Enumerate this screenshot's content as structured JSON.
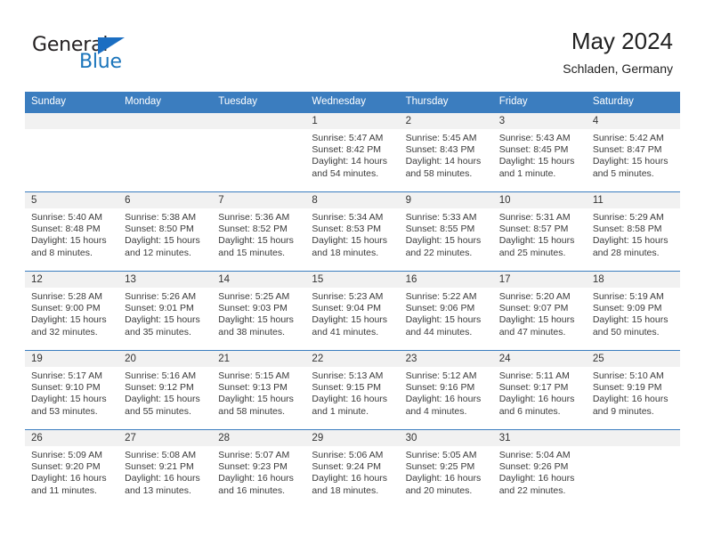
{
  "brand": {
    "name_part1": "General",
    "name_part2": "Blue",
    "flag_icon": "triangle-flag-icon"
  },
  "header": {
    "month_title": "May 2024",
    "location": "Schladen, Germany"
  },
  "colors": {
    "header_blue": "#3b7dbf",
    "brand_blue": "#1b75bb",
    "daynum_strip": "#f1f1f1",
    "text": "#3a3a3a"
  },
  "weekday_headers": [
    "Sunday",
    "Monday",
    "Tuesday",
    "Wednesday",
    "Thursday",
    "Friday",
    "Saturday"
  ],
  "weeks": [
    [
      {
        "day": "",
        "empty": true,
        "sunrise": "",
        "sunset": "",
        "daylight_line1": "",
        "daylight_line2": ""
      },
      {
        "day": "",
        "empty": true,
        "sunrise": "",
        "sunset": "",
        "daylight_line1": "",
        "daylight_line2": ""
      },
      {
        "day": "",
        "empty": true,
        "sunrise": "",
        "sunset": "",
        "daylight_line1": "",
        "daylight_line2": ""
      },
      {
        "day": "1",
        "empty": false,
        "sunrise": "Sunrise: 5:47 AM",
        "sunset": "Sunset: 8:42 PM",
        "daylight_line1": "Daylight: 14 hours",
        "daylight_line2": "and 54 minutes."
      },
      {
        "day": "2",
        "empty": false,
        "sunrise": "Sunrise: 5:45 AM",
        "sunset": "Sunset: 8:43 PM",
        "daylight_line1": "Daylight: 14 hours",
        "daylight_line2": "and 58 minutes."
      },
      {
        "day": "3",
        "empty": false,
        "sunrise": "Sunrise: 5:43 AM",
        "sunset": "Sunset: 8:45 PM",
        "daylight_line1": "Daylight: 15 hours",
        "daylight_line2": "and 1 minute."
      },
      {
        "day": "4",
        "empty": false,
        "sunrise": "Sunrise: 5:42 AM",
        "sunset": "Sunset: 8:47 PM",
        "daylight_line1": "Daylight: 15 hours",
        "daylight_line2": "and 5 minutes."
      }
    ],
    [
      {
        "day": "5",
        "empty": false,
        "sunrise": "Sunrise: 5:40 AM",
        "sunset": "Sunset: 8:48 PM",
        "daylight_line1": "Daylight: 15 hours",
        "daylight_line2": "and 8 minutes."
      },
      {
        "day": "6",
        "empty": false,
        "sunrise": "Sunrise: 5:38 AM",
        "sunset": "Sunset: 8:50 PM",
        "daylight_line1": "Daylight: 15 hours",
        "daylight_line2": "and 12 minutes."
      },
      {
        "day": "7",
        "empty": false,
        "sunrise": "Sunrise: 5:36 AM",
        "sunset": "Sunset: 8:52 PM",
        "daylight_line1": "Daylight: 15 hours",
        "daylight_line2": "and 15 minutes."
      },
      {
        "day": "8",
        "empty": false,
        "sunrise": "Sunrise: 5:34 AM",
        "sunset": "Sunset: 8:53 PM",
        "daylight_line1": "Daylight: 15 hours",
        "daylight_line2": "and 18 minutes."
      },
      {
        "day": "9",
        "empty": false,
        "sunrise": "Sunrise: 5:33 AM",
        "sunset": "Sunset: 8:55 PM",
        "daylight_line1": "Daylight: 15 hours",
        "daylight_line2": "and 22 minutes."
      },
      {
        "day": "10",
        "empty": false,
        "sunrise": "Sunrise: 5:31 AM",
        "sunset": "Sunset: 8:57 PM",
        "daylight_line1": "Daylight: 15 hours",
        "daylight_line2": "and 25 minutes."
      },
      {
        "day": "11",
        "empty": false,
        "sunrise": "Sunrise: 5:29 AM",
        "sunset": "Sunset: 8:58 PM",
        "daylight_line1": "Daylight: 15 hours",
        "daylight_line2": "and 28 minutes."
      }
    ],
    [
      {
        "day": "12",
        "empty": false,
        "sunrise": "Sunrise: 5:28 AM",
        "sunset": "Sunset: 9:00 PM",
        "daylight_line1": "Daylight: 15 hours",
        "daylight_line2": "and 32 minutes."
      },
      {
        "day": "13",
        "empty": false,
        "sunrise": "Sunrise: 5:26 AM",
        "sunset": "Sunset: 9:01 PM",
        "daylight_line1": "Daylight: 15 hours",
        "daylight_line2": "and 35 minutes."
      },
      {
        "day": "14",
        "empty": false,
        "sunrise": "Sunrise: 5:25 AM",
        "sunset": "Sunset: 9:03 PM",
        "daylight_line1": "Daylight: 15 hours",
        "daylight_line2": "and 38 minutes."
      },
      {
        "day": "15",
        "empty": false,
        "sunrise": "Sunrise: 5:23 AM",
        "sunset": "Sunset: 9:04 PM",
        "daylight_line1": "Daylight: 15 hours",
        "daylight_line2": "and 41 minutes."
      },
      {
        "day": "16",
        "empty": false,
        "sunrise": "Sunrise: 5:22 AM",
        "sunset": "Sunset: 9:06 PM",
        "daylight_line1": "Daylight: 15 hours",
        "daylight_line2": "and 44 minutes."
      },
      {
        "day": "17",
        "empty": false,
        "sunrise": "Sunrise: 5:20 AM",
        "sunset": "Sunset: 9:07 PM",
        "daylight_line1": "Daylight: 15 hours",
        "daylight_line2": "and 47 minutes."
      },
      {
        "day": "18",
        "empty": false,
        "sunrise": "Sunrise: 5:19 AM",
        "sunset": "Sunset: 9:09 PM",
        "daylight_line1": "Daylight: 15 hours",
        "daylight_line2": "and 50 minutes."
      }
    ],
    [
      {
        "day": "19",
        "empty": false,
        "sunrise": "Sunrise: 5:17 AM",
        "sunset": "Sunset: 9:10 PM",
        "daylight_line1": "Daylight: 15 hours",
        "daylight_line2": "and 53 minutes."
      },
      {
        "day": "20",
        "empty": false,
        "sunrise": "Sunrise: 5:16 AM",
        "sunset": "Sunset: 9:12 PM",
        "daylight_line1": "Daylight: 15 hours",
        "daylight_line2": "and 55 minutes."
      },
      {
        "day": "21",
        "empty": false,
        "sunrise": "Sunrise: 5:15 AM",
        "sunset": "Sunset: 9:13 PM",
        "daylight_line1": "Daylight: 15 hours",
        "daylight_line2": "and 58 minutes."
      },
      {
        "day": "22",
        "empty": false,
        "sunrise": "Sunrise: 5:13 AM",
        "sunset": "Sunset: 9:15 PM",
        "daylight_line1": "Daylight: 16 hours",
        "daylight_line2": "and 1 minute."
      },
      {
        "day": "23",
        "empty": false,
        "sunrise": "Sunrise: 5:12 AM",
        "sunset": "Sunset: 9:16 PM",
        "daylight_line1": "Daylight: 16 hours",
        "daylight_line2": "and 4 minutes."
      },
      {
        "day": "24",
        "empty": false,
        "sunrise": "Sunrise: 5:11 AM",
        "sunset": "Sunset: 9:17 PM",
        "daylight_line1": "Daylight: 16 hours",
        "daylight_line2": "and 6 minutes."
      },
      {
        "day": "25",
        "empty": false,
        "sunrise": "Sunrise: 5:10 AM",
        "sunset": "Sunset: 9:19 PM",
        "daylight_line1": "Daylight: 16 hours",
        "daylight_line2": "and 9 minutes."
      }
    ],
    [
      {
        "day": "26",
        "empty": false,
        "sunrise": "Sunrise: 5:09 AM",
        "sunset": "Sunset: 9:20 PM",
        "daylight_line1": "Daylight: 16 hours",
        "daylight_line2": "and 11 minutes."
      },
      {
        "day": "27",
        "empty": false,
        "sunrise": "Sunrise: 5:08 AM",
        "sunset": "Sunset: 9:21 PM",
        "daylight_line1": "Daylight: 16 hours",
        "daylight_line2": "and 13 minutes."
      },
      {
        "day": "28",
        "empty": false,
        "sunrise": "Sunrise: 5:07 AM",
        "sunset": "Sunset: 9:23 PM",
        "daylight_line1": "Daylight: 16 hours",
        "daylight_line2": "and 16 minutes."
      },
      {
        "day": "29",
        "empty": false,
        "sunrise": "Sunrise: 5:06 AM",
        "sunset": "Sunset: 9:24 PM",
        "daylight_line1": "Daylight: 16 hours",
        "daylight_line2": "and 18 minutes."
      },
      {
        "day": "30",
        "empty": false,
        "sunrise": "Sunrise: 5:05 AM",
        "sunset": "Sunset: 9:25 PM",
        "daylight_line1": "Daylight: 16 hours",
        "daylight_line2": "and 20 minutes."
      },
      {
        "day": "31",
        "empty": false,
        "sunrise": "Sunrise: 5:04 AM",
        "sunset": "Sunset: 9:26 PM",
        "daylight_line1": "Daylight: 16 hours",
        "daylight_line2": "and 22 minutes."
      },
      {
        "day": "",
        "empty": true,
        "sunrise": "",
        "sunset": "",
        "daylight_line1": "",
        "daylight_line2": ""
      }
    ]
  ]
}
